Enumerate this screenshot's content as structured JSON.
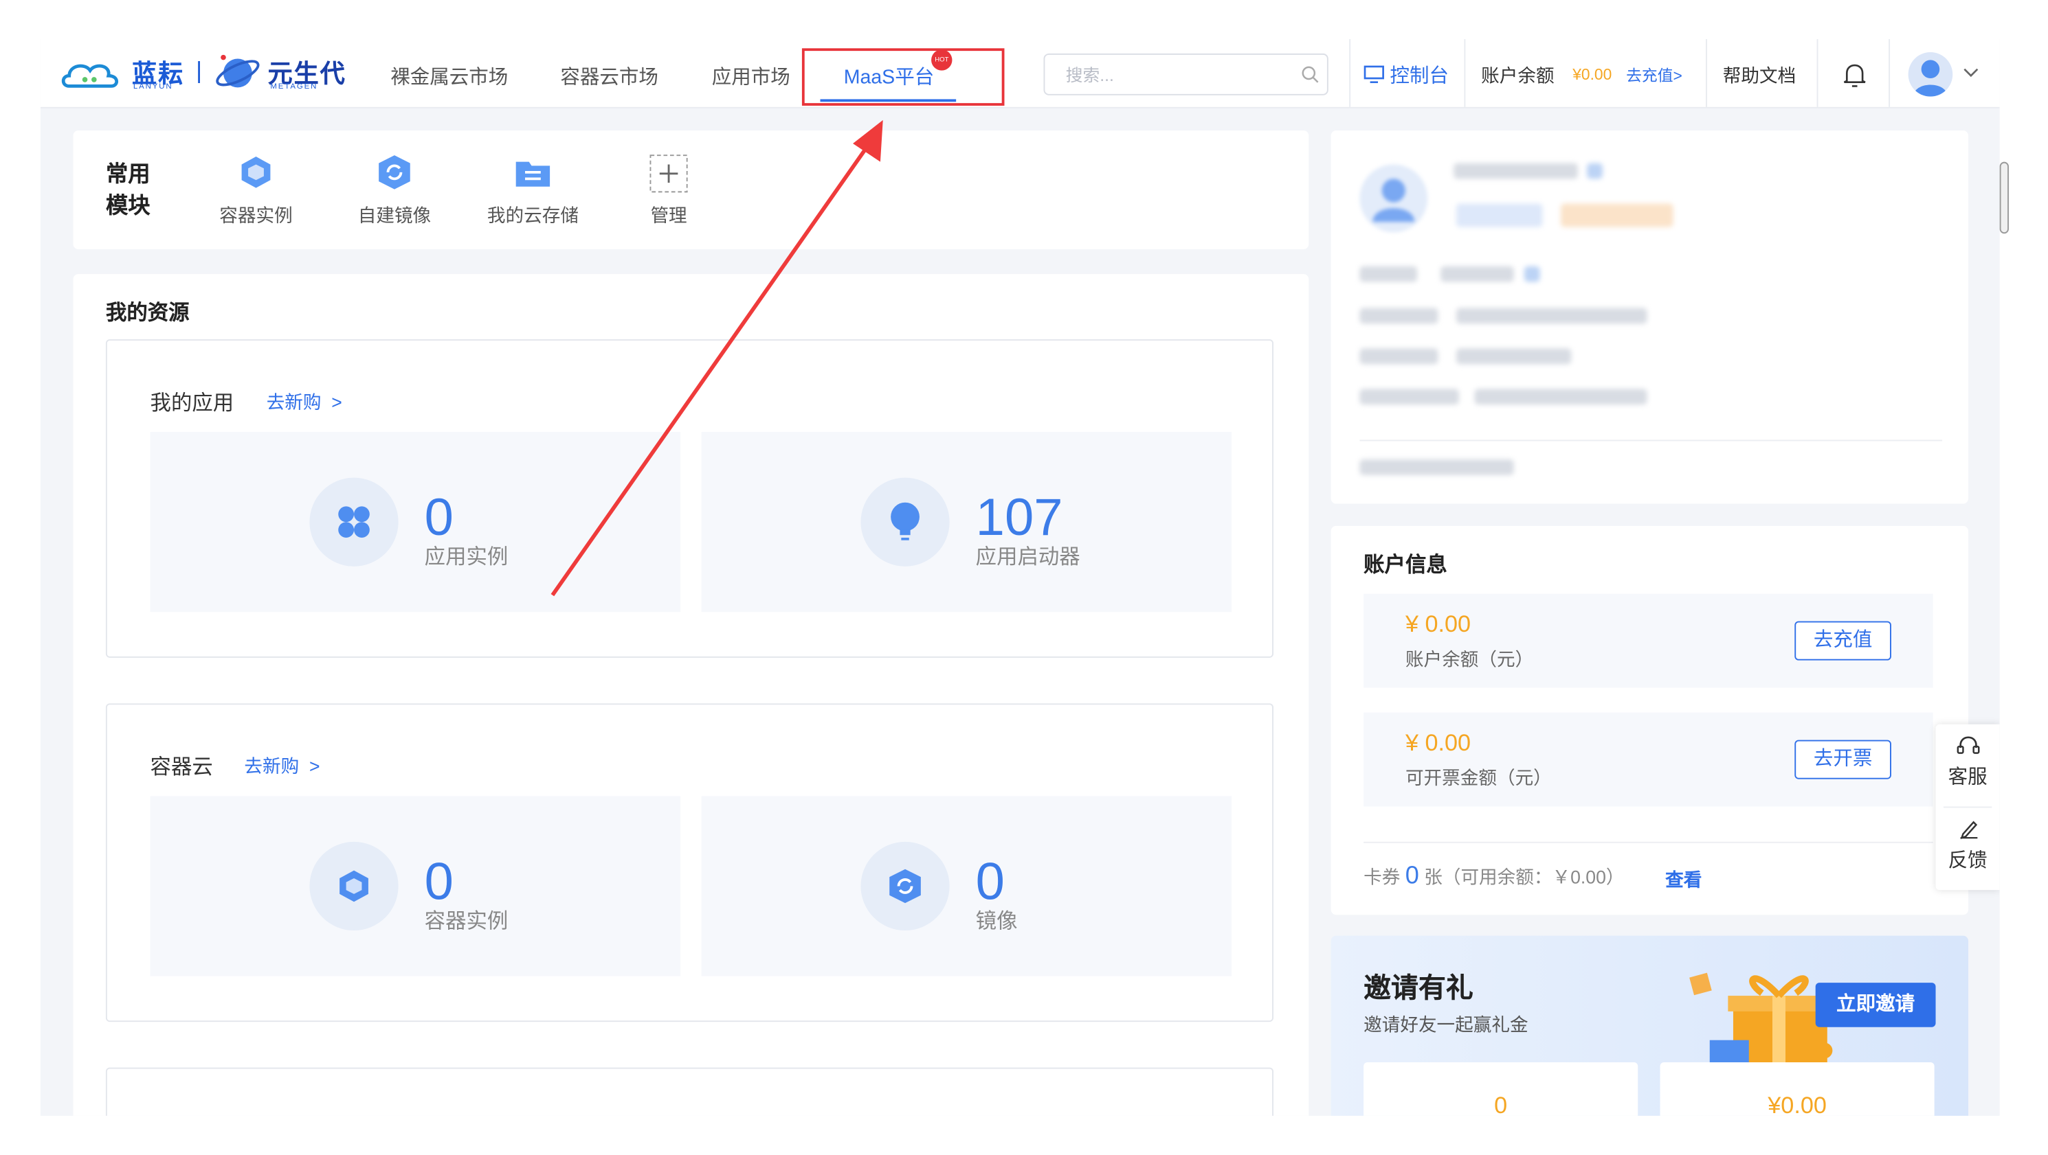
{
  "brand": {
    "logo1_text": "蓝耘",
    "logo1_sub": "LANYUN",
    "separator": "|",
    "logo2_text": "元生代",
    "logo2_sub": "METAGEN"
  },
  "nav": [
    {
      "label": "裸金属云市场"
    },
    {
      "label": "容器云市场"
    },
    {
      "label": "应用市场"
    },
    {
      "label": "MaaS平台",
      "badge": "HOT"
    }
  ],
  "search": {
    "placeholder": "搜索..."
  },
  "header": {
    "console_label": "控制台",
    "balance_label": "账户余额",
    "balance_value": "¥0.00",
    "recharge_link": "去充值>",
    "docs_label": "帮助文档"
  },
  "quick_modules": {
    "title_line1": "常用",
    "title_line2": "模块",
    "items": [
      {
        "label": "容器实例",
        "icon": "cube-icon"
      },
      {
        "label": "自建镜像",
        "icon": "refresh-hexagon-icon"
      },
      {
        "label": "我的云存储",
        "icon": "folder-icon"
      },
      {
        "label": "管理",
        "icon": "plus-icon"
      }
    ]
  },
  "resources": {
    "title": "我的资源",
    "apps": {
      "title": "我的应用",
      "buy_link": "去新购",
      "chevron": ">",
      "stats": [
        {
          "value": "0",
          "label": "应用实例"
        },
        {
          "value": "107",
          "label": "应用启动器"
        }
      ]
    },
    "container": {
      "title": "容器云",
      "buy_link": "去新购",
      "chevron": ">",
      "stats": [
        {
          "value": "0",
          "label": "容器实例"
        },
        {
          "value": "0",
          "label": "镜像"
        }
      ]
    }
  },
  "account": {
    "title": "账户信息",
    "balance": {
      "value": "¥ 0.00",
      "label": "账户余额（元）",
      "button": "去充值"
    },
    "invoice": {
      "value": "¥ 0.00",
      "label": "可开票金额（元）",
      "button": "去开票"
    },
    "coupon": {
      "prefix": "卡券",
      "count": "0",
      "suffix": "张（可用余额：￥0.00）",
      "view_link": "查看"
    }
  },
  "invite": {
    "title": "邀请有礼",
    "subtitle": "邀请好友一起赢礼金",
    "button": "立即邀请",
    "count_value": "0",
    "money_value": "¥0.00"
  },
  "float_panel": {
    "service": "客服",
    "feedback": "反馈"
  },
  "colors": {
    "accent": "#2f6fe8",
    "highlight_box": "#e8343a",
    "arrow": "#ef3b3b",
    "money": "#f5a623",
    "invite_button": "#2f6fe8"
  }
}
